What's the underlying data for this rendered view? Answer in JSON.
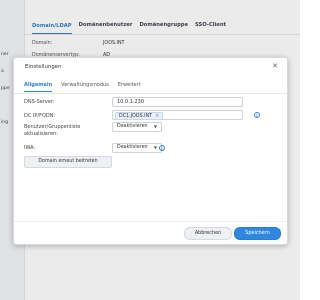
{
  "background": {
    "sidebar_items": [
      "ner",
      "a",
      "ppe",
      "ing"
    ],
    "tabs": [
      {
        "label": "Domain/LDAP",
        "active": true
      },
      {
        "label": "Domänenbenutzer",
        "active": false
      },
      {
        "label": "Domänengruppe",
        "active": false
      },
      {
        "label": "SSO-Client",
        "active": false
      }
    ],
    "fields": [
      {
        "label": "Domain:",
        "value": "JOOS.INT"
      },
      {
        "label": "Domänenservertyp:",
        "value": "AD"
      }
    ]
  },
  "dialog": {
    "title": "Einstellungen",
    "close_icon": "close-icon",
    "tabs": [
      {
        "label": "Allgemein",
        "active": true
      },
      {
        "label": "Verwaltungsmodus",
        "active": false
      },
      {
        "label": "Erweitert",
        "active": false
      }
    ],
    "dns_label": "DNS-Server:",
    "dns_value": "10.0.1.230",
    "dc_label": "DC IP/FQDN:",
    "dc_chip": "DC1.JOOS.INT",
    "sync_label_line1": "Benutzer/Gruppenliste",
    "sync_label_line2": "aktualisieren:",
    "sync_value": "Deaktivieren",
    "iwa_label": "IWA:",
    "iwa_value": "Deaktivieren",
    "rejoin_button": "Domain erneut beitreten",
    "cancel_button": "Abbrechen",
    "save_button": "Speichern"
  },
  "colors": {
    "accent": "#2f87e0",
    "tab_active": "#2e7fd6"
  }
}
